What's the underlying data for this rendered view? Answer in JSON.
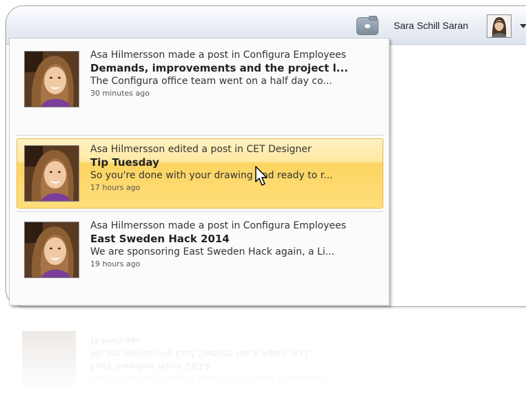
{
  "header": {
    "user_name": "Sara Schill Saran",
    "chat_icon": "chat-icon",
    "avatar_icon": "user-avatar",
    "menu_icon": "caret-down-icon"
  },
  "notifications": [
    {
      "action": "Asa Hilmersson made a post in Configura Employees",
      "title": "Demands, improvements and the project l...",
      "snippet": "The Configura office team went on a half day co...",
      "time": "30 minutes ago",
      "highlighted": false
    },
    {
      "action": "Asa Hilmersson edited a post in CET Designer",
      "title": "Tip Tuesday",
      "snippet": "So you're done with your drawing and ready to r...",
      "time": "17 hours ago",
      "highlighted": true
    },
    {
      "action": "Asa Hilmersson made a post in Configura Employees",
      "title": "East Sweden Hack 2014",
      "snippet": "We are sponsoring East Sweden Hack again, a Li...",
      "time": "19 hours ago",
      "highlighted": false
    }
  ],
  "colors": {
    "highlight": "#fcd562",
    "highlight_border": "#e8b84a",
    "topbar": "#dde3ee"
  }
}
